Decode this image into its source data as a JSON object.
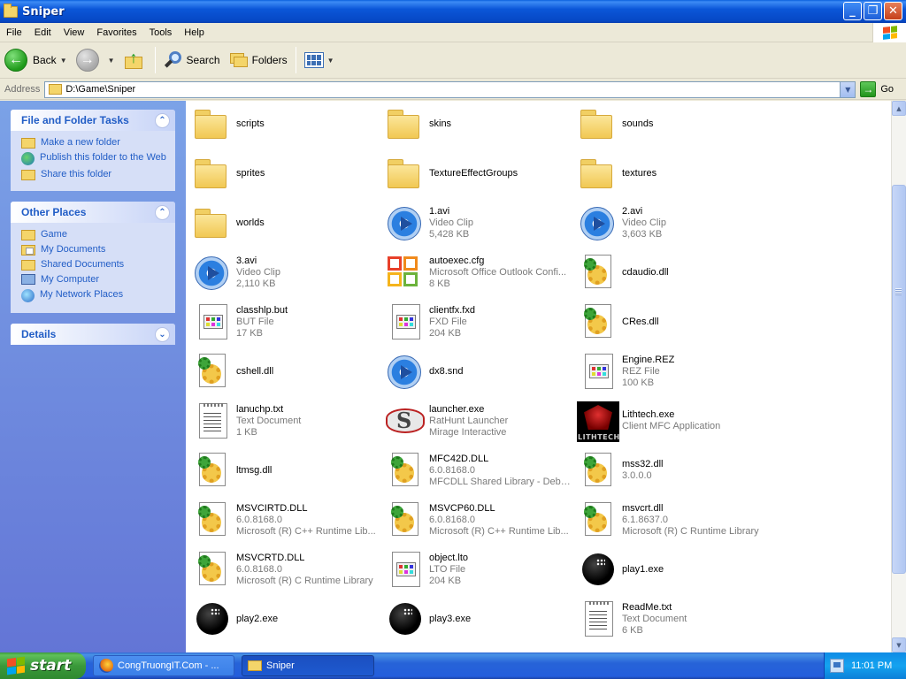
{
  "window": {
    "title": "Sniper",
    "controls": [
      "_",
      "❐",
      "✕"
    ]
  },
  "menu": [
    "File",
    "Edit",
    "View",
    "Favorites",
    "Tools",
    "Help"
  ],
  "toolbar": {
    "back": "Back",
    "search": "Search",
    "folders": "Folders"
  },
  "address": {
    "label": "Address",
    "path": "D:\\Game\\Sniper",
    "go": "Go"
  },
  "sidebar": {
    "file_tasks": {
      "title": "File and Folder Tasks",
      "items": [
        "Make a new folder",
        "Publish this folder to the Web",
        "Share this folder"
      ]
    },
    "other_places": {
      "title": "Other Places",
      "items": [
        "Game",
        "My Documents",
        "Shared Documents",
        "My Computer",
        "My Network Places"
      ]
    },
    "details": {
      "title": "Details"
    }
  },
  "files": [
    {
      "name": "scripts",
      "type": "folder"
    },
    {
      "name": "skins",
      "type": "folder"
    },
    {
      "name": "sounds",
      "type": "folder"
    },
    {
      "name": "sprites",
      "type": "folder"
    },
    {
      "name": "TextureEffectGroups",
      "type": "folder"
    },
    {
      "name": "textures",
      "type": "folder"
    },
    {
      "name": "worlds",
      "type": "folder"
    },
    {
      "name": "1.avi",
      "line2": "Video Clip",
      "line3": "5,428 KB",
      "type": "video"
    },
    {
      "name": "2.avi",
      "line2": "Video Clip",
      "line3": "3,603 KB",
      "type": "video"
    },
    {
      "name": "3.avi",
      "line2": "Video Clip",
      "line3": "2,110 KB",
      "type": "video"
    },
    {
      "name": "autoexec.cfg",
      "line2": "Microsoft Office Outlook Confi...",
      "line3": "8 KB",
      "type": "office"
    },
    {
      "name": "cdaudio.dll",
      "type": "dll"
    },
    {
      "name": "classhlp.but",
      "line2": "BUT File",
      "line3": "17 KB",
      "type": "file"
    },
    {
      "name": "clientfx.fxd",
      "line2": "FXD File",
      "line3": "204 KB",
      "type": "file"
    },
    {
      "name": "CRes.dll",
      "type": "dll"
    },
    {
      "name": "cshell.dll",
      "type": "dll"
    },
    {
      "name": "dx8.snd",
      "type": "video"
    },
    {
      "name": "Engine.REZ",
      "line2": "REZ File",
      "line3": "100 KB",
      "type": "file"
    },
    {
      "name": "lanuchp.txt",
      "line2": "Text Document",
      "line3": "1 KB",
      "type": "text"
    },
    {
      "name": "launcher.exe",
      "line2": "RatHunt Launcher",
      "line3": "Mirage Interactive",
      "type": "launcher"
    },
    {
      "name": "Lithtech.exe",
      "line2": "Client MFC Application",
      "type": "lithtech",
      "logo_text": "LITHTECH"
    },
    {
      "name": "ltmsg.dll",
      "type": "dll"
    },
    {
      "name": "MFC42D.DLL",
      "line2": "6.0.8168.0",
      "line3": "MFCDLL Shared Library - Debu...",
      "type": "dll"
    },
    {
      "name": "mss32.dll",
      "line2": "3.0.0.0",
      "type": "dll"
    },
    {
      "name": "MSVCIRTD.DLL",
      "line2": "6.0.8168.0",
      "line3": "Microsoft (R) C++ Runtime Lib...",
      "type": "dll"
    },
    {
      "name": "MSVCP60.DLL",
      "line2": "6.0.8168.0",
      "line3": "Microsoft (R) C++ Runtime Lib...",
      "type": "dll"
    },
    {
      "name": "msvcrt.dll",
      "line2": "6.1.8637.0",
      "line3": "Microsoft (R) C Runtime Library",
      "type": "dll"
    },
    {
      "name": "MSVCRTD.DLL",
      "line2": "6.0.8168.0",
      "line3": "Microsoft (R) C Runtime Library",
      "type": "dll"
    },
    {
      "name": "object.lto",
      "line2": "LTO File",
      "line3": "204 KB",
      "type": "file"
    },
    {
      "name": "play1.exe",
      "type": "bomb"
    },
    {
      "name": "play2.exe",
      "type": "bomb"
    },
    {
      "name": "play3.exe",
      "type": "bomb"
    },
    {
      "name": "ReadMe.txt",
      "line2": "Text Document",
      "line3": "6 KB",
      "type": "text"
    }
  ],
  "taskbar": {
    "start": "start",
    "tasks": [
      {
        "label": "CongTruongIT.Com - ...",
        "icon": "firefox-icon"
      },
      {
        "label": "Sniper",
        "icon": "folder-icon",
        "active": true
      }
    ],
    "clock": "11:01 PM"
  }
}
